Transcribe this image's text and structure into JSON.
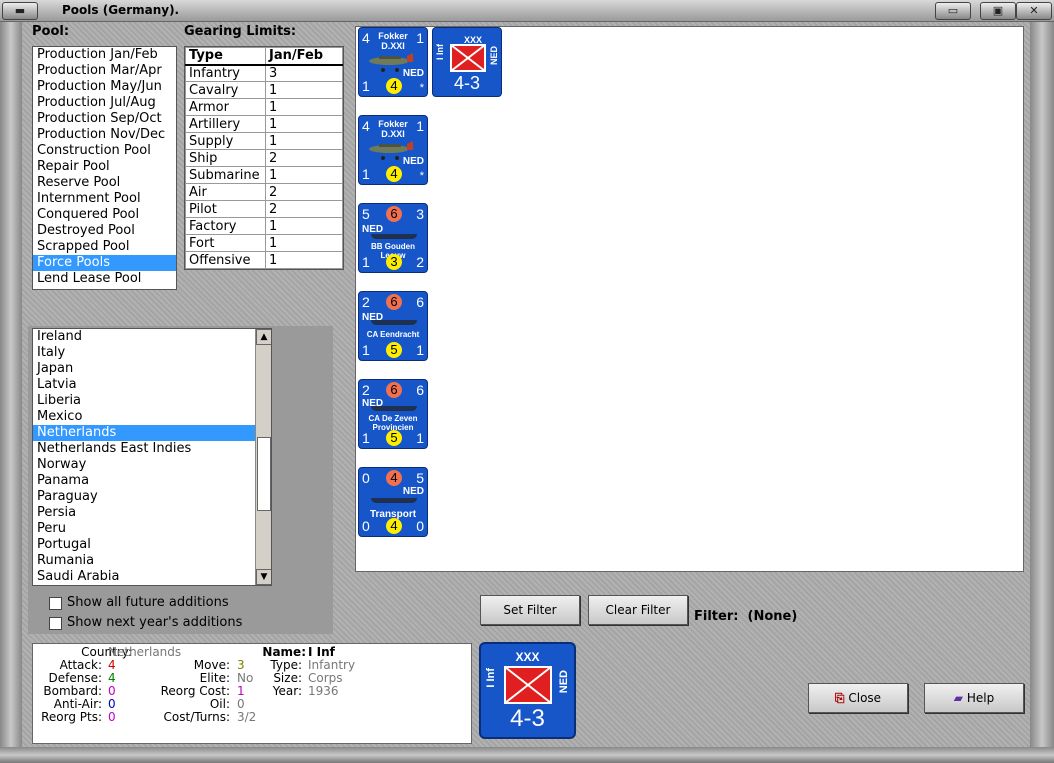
{
  "window": {
    "title": "Pools (Germany)."
  },
  "labels": {
    "pool": "Pool:",
    "gearing": "Gearing Limits:"
  },
  "pools": [
    "Production Jan/Feb",
    "Production Mar/Apr",
    "Production May/Jun",
    "Production Jul/Aug",
    "Production Sep/Oct",
    "Production Nov/Dec",
    "Construction Pool",
    "Repair Pool",
    "Reserve Pool",
    "Internment Pool",
    "Conquered Pool",
    "Destroyed Pool",
    "Scrapped Pool",
    "Force Pools",
    "Lend Lease Pool"
  ],
  "pool_selected": "Force Pools",
  "gearing": {
    "headers": [
      "Type",
      "Jan/Feb"
    ],
    "rows": [
      [
        "Infantry",
        "3"
      ],
      [
        "Cavalry",
        "1"
      ],
      [
        "Armor",
        "1"
      ],
      [
        "Artillery",
        "1"
      ],
      [
        "Supply",
        "1"
      ],
      [
        "Ship",
        "2"
      ],
      [
        "Submarine",
        "1"
      ],
      [
        "Air",
        "2"
      ],
      [
        "Pilot",
        "2"
      ],
      [
        "Factory",
        "1"
      ],
      [
        "Fort",
        "1"
      ],
      [
        "Offensive",
        "1"
      ]
    ]
  },
  "countries": [
    "Ireland",
    "Italy",
    "Japan",
    "Latvia",
    "Liberia",
    "Mexico",
    "Netherlands",
    "Netherlands East Indies",
    "Norway",
    "Panama",
    "Paraguay",
    "Persia",
    "Peru",
    "Portugal",
    "Rumania",
    "Saudi Arabia"
  ],
  "country_selected": "Netherlands",
  "scroll_arrows": {
    "up": "▲",
    "down": "▼"
  },
  "checks": {
    "future": "Show all future additions",
    "next_year": "Show next year's additions"
  },
  "counters": {
    "c1": {
      "tl": "4",
      "tr": "1",
      "bl": "1",
      "bc": "4",
      "br": "*",
      "name1": "Fokker",
      "name2": "D.XXI",
      "ned": "NED"
    },
    "c2": {
      "top": "XXX",
      "side": "I Inf",
      "ned": "NED",
      "val": "4-3"
    },
    "c3": {
      "tl": "4",
      "tr": "1",
      "bl": "1",
      "bc": "4",
      "br": "*",
      "name1": "Fokker",
      "name2": "D.XXI",
      "ned": "NED"
    },
    "c4": {
      "tl": "5",
      "tc": "6",
      "tr": "3",
      "bl": "1",
      "bc": "3",
      "br": "2",
      "ned": "NED",
      "name": "BB Gouden Leeuw"
    },
    "c5": {
      "tl": "2",
      "tc": "6",
      "tr": "6",
      "bl": "1",
      "bc": "5",
      "br": "1",
      "ned": "NED",
      "name": "CA Eendracht"
    },
    "c6": {
      "tl": "2",
      "tc": "6",
      "tr": "6",
      "bl": "1",
      "bc": "5",
      "br": "1",
      "ned": "NED",
      "name1": "CA De Zeven",
      "name2": "Provincien"
    },
    "c7": {
      "tl": "0",
      "tc": "4",
      "tr": "5",
      "bl": "0",
      "bc": "4",
      "br": "0",
      "ned": "NED",
      "name": "Transport"
    }
  },
  "buttons": {
    "set_filter": "Set Filter",
    "clear_filter": "Clear Filter",
    "close": "Close",
    "help": "Help"
  },
  "filter": {
    "label": "Filter:",
    "value": "(None)"
  },
  "info": {
    "country_k": "Country:",
    "country_v": "Netherlands",
    "attack_k": "Attack:",
    "attack_v": "4",
    "defense_k": "Defense:",
    "defense_v": "4",
    "bombard_k": "Bombard:",
    "bombard_v": "0",
    "antiair_k": "Anti-Air:",
    "antiair_v": "0",
    "reorgpts_k": "Reorg Pts:",
    "reorgpts_v": "0",
    "move_k": "Move:",
    "move_v": "3",
    "elite_k": "Elite:",
    "elite_v": "No",
    "reorgcost_k": "Reorg Cost:",
    "reorgcost_v": "1",
    "oil_k": "Oil:",
    "oil_v": "0",
    "costturns_k": "Cost/Turns:",
    "costturns_v": "3/2",
    "name_k": "Name:",
    "name_v": "I Inf",
    "type_k": "Type:",
    "type_v": "Infantry",
    "size_k": "Size:",
    "size_v": "Corps",
    "year_k": "Year:",
    "year_v": "1936"
  },
  "big_counter": {
    "top": "XXX",
    "side": "I Inf",
    "ned": "NED",
    "val": "4-3"
  },
  "colors": {
    "counter_blue": "#1656c8",
    "selection": "#3399ff"
  }
}
